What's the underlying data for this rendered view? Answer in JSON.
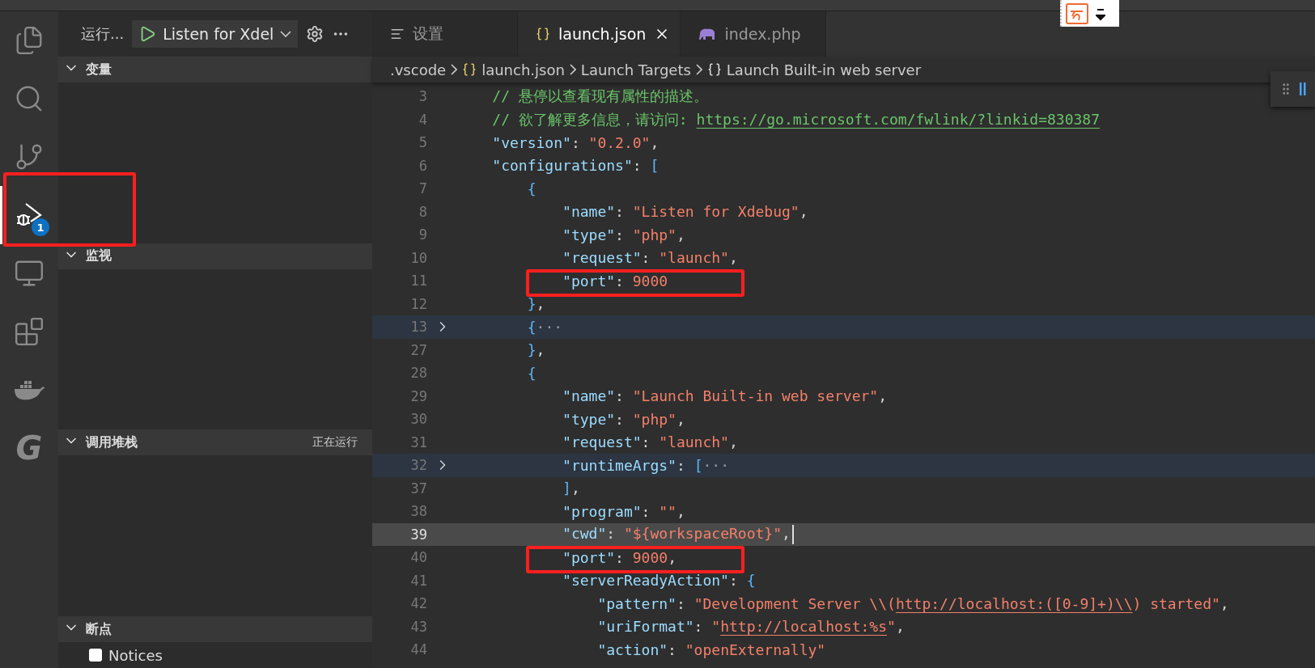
{
  "activity_bar": [
    {
      "kind": "files",
      "selected": false,
      "annotated": false
    },
    {
      "kind": "search",
      "selected": false,
      "annotated": false
    },
    {
      "kind": "source-control",
      "selected": false,
      "annotated": false
    },
    {
      "kind": "debug",
      "selected": true,
      "annotated": true,
      "badge": "1"
    },
    {
      "kind": "remote",
      "selected": false,
      "annotated": false
    },
    {
      "kind": "extensions",
      "selected": false,
      "annotated": false
    },
    {
      "kind": "docker",
      "selected": false,
      "annotated": false
    },
    {
      "kind": "logo",
      "selected": false,
      "annotated": false,
      "glyph": "G"
    }
  ],
  "debug_toolbar": {
    "run_label": "运行...",
    "configuration": "Listen for Xdel"
  },
  "sections": [
    {
      "title": "变量",
      "expanded": true
    },
    {
      "title": "监视",
      "expanded": true
    },
    {
      "title": "调用堆栈",
      "expanded": true,
      "status": "正在运行"
    },
    {
      "title": "断点",
      "expanded": true,
      "items": [
        {
          "label": "Notices",
          "checked": false
        }
      ]
    }
  ],
  "tabs": [
    {
      "label": "设置",
      "kind": "settings",
      "selected": false
    },
    {
      "label": "launch.json",
      "kind": "json",
      "selected": true
    },
    {
      "label": "index.php",
      "kind": "php",
      "selected": false
    }
  ],
  "breadcrumbs": [
    {
      "label": ".vscode",
      "kind": "folder"
    },
    {
      "label": "launch.json",
      "kind": "json"
    },
    {
      "label": "Launch Targets",
      "kind": "folder"
    },
    {
      "label": "Launch Built-in web server",
      "kind": "object"
    }
  ],
  "lines": [
    {
      "number": "3",
      "folded": false,
      "current": false,
      "annotated": false,
      "tokens": [
        {
          "kind": "comment",
          "text": "    // 悬停以查看现有属性的描述。"
        }
      ]
    },
    {
      "number": "4",
      "folded": false,
      "current": false,
      "annotated": false,
      "tokens": [
        {
          "kind": "comment",
          "text": "    // 欲了解更多信息，请访问: "
        },
        {
          "kind": "link",
          "text": "https://go.microsoft.com/fwlink/?linkid=830387"
        }
      ]
    },
    {
      "number": "5",
      "folded": false,
      "current": false,
      "annotated": false,
      "tokens": [
        {
          "kind": "key",
          "text": "    \"version\""
        },
        {
          "kind": "punct",
          "text": ": "
        },
        {
          "kind": "string",
          "text": "\"0.2.0\""
        },
        {
          "kind": "punct",
          "text": ","
        }
      ]
    },
    {
      "number": "6",
      "folded": false,
      "current": false,
      "annotated": false,
      "tokens": [
        {
          "kind": "key",
          "text": "    \"configurations\""
        },
        {
          "kind": "punct",
          "text": ": "
        },
        {
          "kind": "bracket",
          "text": "["
        }
      ]
    },
    {
      "number": "7",
      "folded": false,
      "current": false,
      "annotated": false,
      "tokens": [
        {
          "kind": "bracket",
          "text": "        {"
        }
      ]
    },
    {
      "number": "8",
      "folded": false,
      "current": false,
      "annotated": false,
      "tokens": [
        {
          "kind": "key",
          "text": "            \"name\""
        },
        {
          "kind": "punct",
          "text": ": "
        },
        {
          "kind": "string",
          "text": "\"Listen for Xdebug\""
        },
        {
          "kind": "punct",
          "text": ","
        }
      ]
    },
    {
      "number": "9",
      "folded": false,
      "current": false,
      "annotated": false,
      "tokens": [
        {
          "kind": "key",
          "text": "            \"type\""
        },
        {
          "kind": "punct",
          "text": ": "
        },
        {
          "kind": "string",
          "text": "\"php\""
        },
        {
          "kind": "punct",
          "text": ","
        }
      ]
    },
    {
      "number": "10",
      "folded": false,
      "current": false,
      "annotated": false,
      "tokens": [
        {
          "kind": "key",
          "text": "            \"request\""
        },
        {
          "kind": "punct",
          "text": ": "
        },
        {
          "kind": "string",
          "text": "\"launch\""
        },
        {
          "kind": "punct",
          "text": ","
        }
      ]
    },
    {
      "number": "11",
      "folded": false,
      "current": false,
      "annotated": true,
      "tokens": [
        {
          "kind": "key",
          "text": "            \"port\""
        },
        {
          "kind": "punct",
          "text": ": "
        },
        {
          "kind": "number",
          "text": "9000"
        }
      ]
    },
    {
      "number": "12",
      "folded": false,
      "current": false,
      "annotated": false,
      "tokens": [
        {
          "kind": "bracket",
          "text": "        }"
        },
        {
          "kind": "punct",
          "text": ","
        }
      ]
    },
    {
      "number": "13",
      "folded": true,
      "current": false,
      "annotated": false,
      "tokens": [
        {
          "kind": "bracket",
          "text": "        {"
        },
        {
          "kind": "ellipsis",
          "text": "···"
        }
      ]
    },
    {
      "number": "27",
      "folded": false,
      "current": false,
      "annotated": false,
      "tokens": [
        {
          "kind": "bracket",
          "text": "        }"
        },
        {
          "kind": "punct",
          "text": ","
        }
      ]
    },
    {
      "number": "28",
      "folded": false,
      "current": false,
      "annotated": false,
      "tokens": [
        {
          "kind": "bracket",
          "text": "        {"
        }
      ]
    },
    {
      "number": "29",
      "folded": false,
      "current": false,
      "annotated": false,
      "tokens": [
        {
          "kind": "key",
          "text": "            \"name\""
        },
        {
          "kind": "punct",
          "text": ": "
        },
        {
          "kind": "string",
          "text": "\"Launch Built-in web server\""
        },
        {
          "kind": "punct",
          "text": ","
        }
      ]
    },
    {
      "number": "30",
      "folded": false,
      "current": false,
      "annotated": false,
      "tokens": [
        {
          "kind": "key",
          "text": "            \"type\""
        },
        {
          "kind": "punct",
          "text": ": "
        },
        {
          "kind": "string",
          "text": "\"php\""
        },
        {
          "kind": "punct",
          "text": ","
        }
      ]
    },
    {
      "number": "31",
      "folded": false,
      "current": false,
      "annotated": false,
      "tokens": [
        {
          "kind": "key",
          "text": "            \"request\""
        },
        {
          "kind": "punct",
          "text": ": "
        },
        {
          "kind": "string",
          "text": "\"launch\""
        },
        {
          "kind": "punct",
          "text": ","
        }
      ]
    },
    {
      "number": "32",
      "folded": true,
      "current": false,
      "annotated": false,
      "tokens": [
        {
          "kind": "key",
          "text": "            \"runtimeArgs\""
        },
        {
          "kind": "punct",
          "text": ": "
        },
        {
          "kind": "bracket",
          "text": "["
        },
        {
          "kind": "ellipsis",
          "text": "···"
        }
      ]
    },
    {
      "number": "37",
      "folded": false,
      "current": false,
      "annotated": false,
      "tokens": [
        {
          "kind": "bracket",
          "text": "            ]"
        },
        {
          "kind": "punct",
          "text": ","
        }
      ]
    },
    {
      "number": "38",
      "folded": false,
      "current": false,
      "annotated": false,
      "tokens": [
        {
          "kind": "key",
          "text": "            \"program\""
        },
        {
          "kind": "punct",
          "text": ": "
        },
        {
          "kind": "string",
          "text": "\"\""
        },
        {
          "kind": "punct",
          "text": ","
        }
      ]
    },
    {
      "number": "39",
      "folded": false,
      "current": true,
      "annotated": false,
      "tokens": [
        {
          "kind": "key",
          "text": "            \"cwd\""
        },
        {
          "kind": "punct",
          "text": ": "
        },
        {
          "kind": "string",
          "text": "\"${workspaceRoot}\""
        },
        {
          "kind": "punct",
          "text": ","
        }
      ]
    },
    {
      "number": "40",
      "folded": false,
      "current": false,
      "annotated": true,
      "tokens": [
        {
          "kind": "key",
          "text": "            \"port\""
        },
        {
          "kind": "punct",
          "text": ": "
        },
        {
          "kind": "number",
          "text": "9000"
        },
        {
          "kind": "punct",
          "text": ","
        }
      ]
    },
    {
      "number": "41",
      "folded": false,
      "current": false,
      "annotated": false,
      "tokens": [
        {
          "kind": "key",
          "text": "            \"serverReadyAction\""
        },
        {
          "kind": "punct",
          "text": ": "
        },
        {
          "kind": "bracket",
          "text": "{"
        }
      ]
    },
    {
      "number": "42",
      "folded": false,
      "current": false,
      "annotated": false,
      "tokens": [
        {
          "kind": "key",
          "text": "                \"pattern\""
        },
        {
          "kind": "punct",
          "text": ": "
        },
        {
          "kind": "string",
          "text": "\"Development Server \\\\("
        },
        {
          "kind": "string-link",
          "text": "http://localhost:([0-9]+)\\\\"
        },
        {
          "kind": "string",
          "text": ") started\""
        },
        {
          "kind": "punct",
          "text": ","
        }
      ]
    },
    {
      "number": "43",
      "folded": false,
      "current": false,
      "annotated": false,
      "tokens": [
        {
          "kind": "key",
          "text": "                \"uriFormat\""
        },
        {
          "kind": "punct",
          "text": ": "
        },
        {
          "kind": "string",
          "text": "\""
        },
        {
          "kind": "string-link",
          "text": "http://localhost:%s"
        },
        {
          "kind": "string",
          "text": "\""
        },
        {
          "kind": "punct",
          "text": ","
        }
      ]
    },
    {
      "number": "44",
      "folded": false,
      "current": false,
      "annotated": false,
      "tokens": [
        {
          "kind": "key",
          "text": "                \"action\""
        },
        {
          "kind": "punct",
          "text": ": "
        },
        {
          "kind": "string",
          "text": "\"openExternally\""
        }
      ]
    }
  ]
}
